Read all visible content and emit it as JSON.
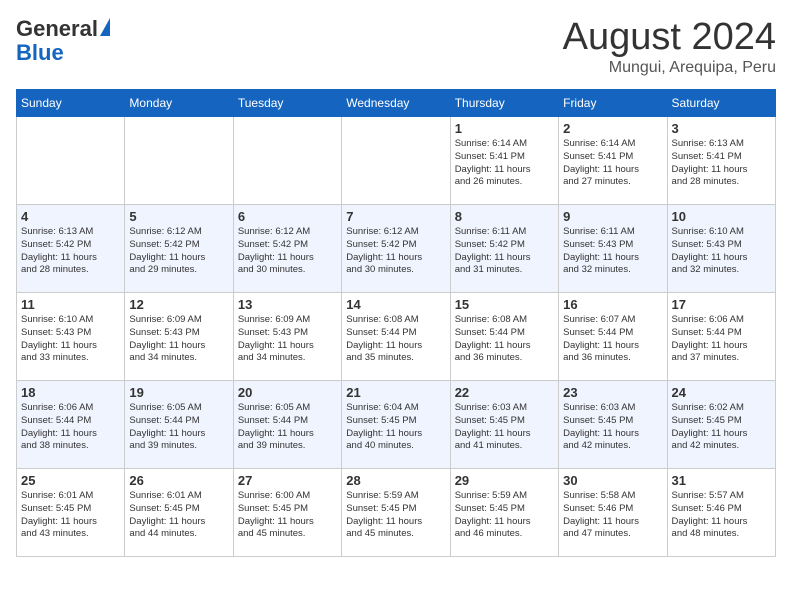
{
  "header": {
    "logo_general": "General",
    "logo_blue": "Blue",
    "title": "August 2024",
    "subtitle": "Mungui, Arequipa, Peru"
  },
  "days_of_week": [
    "Sunday",
    "Monday",
    "Tuesday",
    "Wednesday",
    "Thursday",
    "Friday",
    "Saturday"
  ],
  "weeks": [
    [
      {
        "day": "",
        "info": ""
      },
      {
        "day": "",
        "info": ""
      },
      {
        "day": "",
        "info": ""
      },
      {
        "day": "",
        "info": ""
      },
      {
        "day": "1",
        "info": "Sunrise: 6:14 AM\nSunset: 5:41 PM\nDaylight: 11 hours\nand 26 minutes."
      },
      {
        "day": "2",
        "info": "Sunrise: 6:14 AM\nSunset: 5:41 PM\nDaylight: 11 hours\nand 27 minutes."
      },
      {
        "day": "3",
        "info": "Sunrise: 6:13 AM\nSunset: 5:41 PM\nDaylight: 11 hours\nand 28 minutes."
      }
    ],
    [
      {
        "day": "4",
        "info": "Sunrise: 6:13 AM\nSunset: 5:42 PM\nDaylight: 11 hours\nand 28 minutes."
      },
      {
        "day": "5",
        "info": "Sunrise: 6:12 AM\nSunset: 5:42 PM\nDaylight: 11 hours\nand 29 minutes."
      },
      {
        "day": "6",
        "info": "Sunrise: 6:12 AM\nSunset: 5:42 PM\nDaylight: 11 hours\nand 30 minutes."
      },
      {
        "day": "7",
        "info": "Sunrise: 6:12 AM\nSunset: 5:42 PM\nDaylight: 11 hours\nand 30 minutes."
      },
      {
        "day": "8",
        "info": "Sunrise: 6:11 AM\nSunset: 5:42 PM\nDaylight: 11 hours\nand 31 minutes."
      },
      {
        "day": "9",
        "info": "Sunrise: 6:11 AM\nSunset: 5:43 PM\nDaylight: 11 hours\nand 32 minutes."
      },
      {
        "day": "10",
        "info": "Sunrise: 6:10 AM\nSunset: 5:43 PM\nDaylight: 11 hours\nand 32 minutes."
      }
    ],
    [
      {
        "day": "11",
        "info": "Sunrise: 6:10 AM\nSunset: 5:43 PM\nDaylight: 11 hours\nand 33 minutes."
      },
      {
        "day": "12",
        "info": "Sunrise: 6:09 AM\nSunset: 5:43 PM\nDaylight: 11 hours\nand 34 minutes."
      },
      {
        "day": "13",
        "info": "Sunrise: 6:09 AM\nSunset: 5:43 PM\nDaylight: 11 hours\nand 34 minutes."
      },
      {
        "day": "14",
        "info": "Sunrise: 6:08 AM\nSunset: 5:44 PM\nDaylight: 11 hours\nand 35 minutes."
      },
      {
        "day": "15",
        "info": "Sunrise: 6:08 AM\nSunset: 5:44 PM\nDaylight: 11 hours\nand 36 minutes."
      },
      {
        "day": "16",
        "info": "Sunrise: 6:07 AM\nSunset: 5:44 PM\nDaylight: 11 hours\nand 36 minutes."
      },
      {
        "day": "17",
        "info": "Sunrise: 6:06 AM\nSunset: 5:44 PM\nDaylight: 11 hours\nand 37 minutes."
      }
    ],
    [
      {
        "day": "18",
        "info": "Sunrise: 6:06 AM\nSunset: 5:44 PM\nDaylight: 11 hours\nand 38 minutes."
      },
      {
        "day": "19",
        "info": "Sunrise: 6:05 AM\nSunset: 5:44 PM\nDaylight: 11 hours\nand 39 minutes."
      },
      {
        "day": "20",
        "info": "Sunrise: 6:05 AM\nSunset: 5:44 PM\nDaylight: 11 hours\nand 39 minutes."
      },
      {
        "day": "21",
        "info": "Sunrise: 6:04 AM\nSunset: 5:45 PM\nDaylight: 11 hours\nand 40 minutes."
      },
      {
        "day": "22",
        "info": "Sunrise: 6:03 AM\nSunset: 5:45 PM\nDaylight: 11 hours\nand 41 minutes."
      },
      {
        "day": "23",
        "info": "Sunrise: 6:03 AM\nSunset: 5:45 PM\nDaylight: 11 hours\nand 42 minutes."
      },
      {
        "day": "24",
        "info": "Sunrise: 6:02 AM\nSunset: 5:45 PM\nDaylight: 11 hours\nand 42 minutes."
      }
    ],
    [
      {
        "day": "25",
        "info": "Sunrise: 6:01 AM\nSunset: 5:45 PM\nDaylight: 11 hours\nand 43 minutes."
      },
      {
        "day": "26",
        "info": "Sunrise: 6:01 AM\nSunset: 5:45 PM\nDaylight: 11 hours\nand 44 minutes."
      },
      {
        "day": "27",
        "info": "Sunrise: 6:00 AM\nSunset: 5:45 PM\nDaylight: 11 hours\nand 45 minutes."
      },
      {
        "day": "28",
        "info": "Sunrise: 5:59 AM\nSunset: 5:45 PM\nDaylight: 11 hours\nand 45 minutes."
      },
      {
        "day": "29",
        "info": "Sunrise: 5:59 AM\nSunset: 5:45 PM\nDaylight: 11 hours\nand 46 minutes."
      },
      {
        "day": "30",
        "info": "Sunrise: 5:58 AM\nSunset: 5:46 PM\nDaylight: 11 hours\nand 47 minutes."
      },
      {
        "day": "31",
        "info": "Sunrise: 5:57 AM\nSunset: 5:46 PM\nDaylight: 11 hours\nand 48 minutes."
      }
    ]
  ]
}
